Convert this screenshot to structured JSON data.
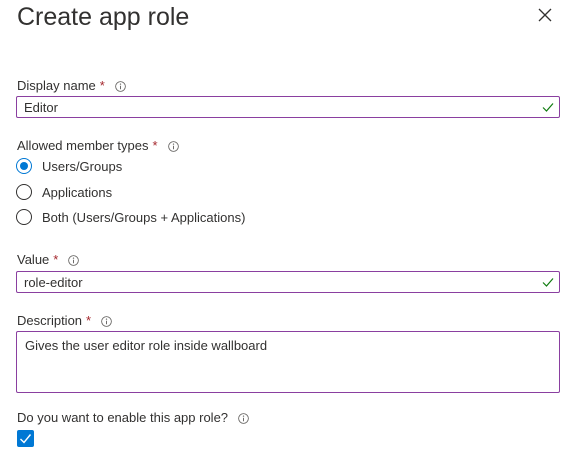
{
  "panel": {
    "title": "Create app role",
    "close_icon": "close-icon"
  },
  "display_name": {
    "label": "Display name",
    "required_mark": "*",
    "value": "Editor"
  },
  "member_types": {
    "label": "Allowed member types",
    "required_mark": "*",
    "options": [
      {
        "label": "Users/Groups",
        "selected": true
      },
      {
        "label": "Applications",
        "selected": false
      },
      {
        "label": "Both (Users/Groups + Applications)",
        "selected": false
      }
    ]
  },
  "value_field": {
    "label": "Value",
    "required_mark": "*",
    "value": "role-editor"
  },
  "description": {
    "label": "Description",
    "required_mark": "*",
    "value": "Gives the user editor role inside wallboard"
  },
  "enable": {
    "label": "Do you want to enable this app role?",
    "checked": true
  },
  "colors": {
    "accent": "#0078d4",
    "required": "#a4262c",
    "valid": "#107c10",
    "field_border": "#8a3fa0"
  }
}
